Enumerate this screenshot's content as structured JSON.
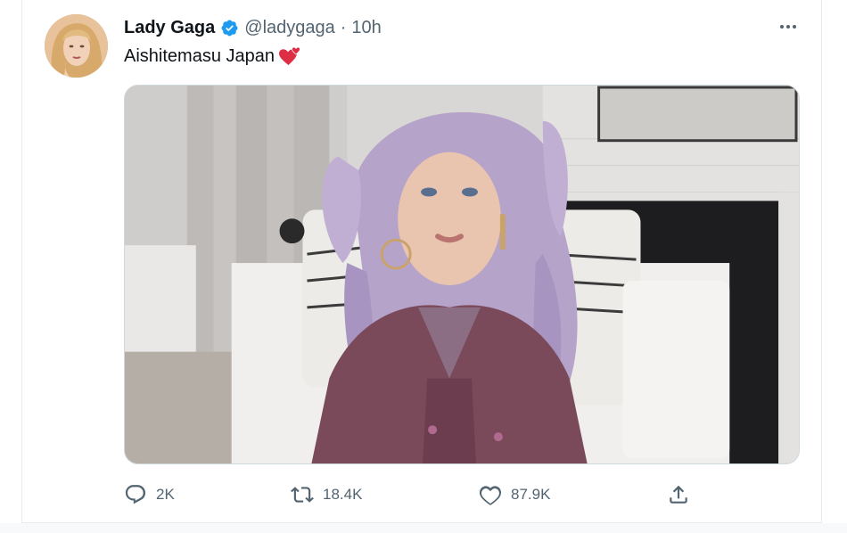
{
  "tweet": {
    "author_name": "Lady Gaga",
    "handle": "@ladygaga",
    "separator": "·",
    "time": "10h",
    "text": "Aishitemasu Japan",
    "emoji": "two-hearts-icon",
    "verified": true,
    "accent_color": "#1d9bf0"
  },
  "actions": {
    "reply_count": "2K",
    "retweet_count": "18.4K",
    "like_count": "87.9K"
  },
  "icons": {
    "reply": "reply-icon",
    "retweet": "retweet-icon",
    "like": "heart-icon",
    "share": "share-icon",
    "more": "more-icon",
    "verified": "verified-badge-icon"
  }
}
